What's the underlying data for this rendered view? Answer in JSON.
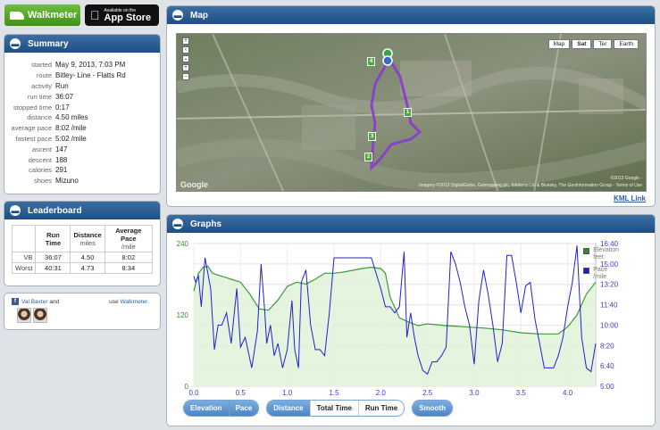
{
  "header": {
    "walkmeter_logo": "Walkmeter",
    "appstore_small": "Available on the",
    "appstore_big": "App Store"
  },
  "summary": {
    "title": "Summary",
    "rows": [
      {
        "label": "started",
        "value": "May 9, 2013, 7:03 PM"
      },
      {
        "label": "route",
        "value": "Bitley- Line - Flatts Rd"
      },
      {
        "label": "activity",
        "value": "Run"
      },
      {
        "label": "run time",
        "value": "36:07"
      },
      {
        "label": "stopped time",
        "value": "0:17"
      },
      {
        "label": "distance",
        "value": "4.50 miles"
      },
      {
        "label": "average pace",
        "value": "8:02 /mile"
      },
      {
        "label": "fastest pace",
        "value": "5:02 /mile"
      },
      {
        "label": "ascent",
        "value": "147"
      },
      {
        "label": "descent",
        "value": "188"
      },
      {
        "label": "calories",
        "value": "291"
      },
      {
        "label": "shoes",
        "value": "Mizuno"
      }
    ]
  },
  "leaderboard": {
    "title": "Leaderboard",
    "headers": {
      "run_time": "Run Time",
      "distance": "Distance",
      "distance_unit": "miles",
      "pace": "Average Pace",
      "pace_unit": "/mile"
    },
    "rows": [
      {
        "name": "VB",
        "time": "36:07",
        "distance": "4.50",
        "pace": "8:02"
      },
      {
        "name": "Worst",
        "time": "40:31",
        "distance": "4.73",
        "pace": "8:34"
      }
    ]
  },
  "social": {
    "name": "Val Baxter",
    "and": "and",
    "use": "use",
    "app": "Walkmeter",
    "dot": "."
  },
  "map": {
    "title": "Map",
    "types": [
      "Map",
      "Sat",
      "Ter",
      "Earth"
    ],
    "selected_type": "Sat",
    "kml_link": "KML Link",
    "copyright_google": "©2013 Google ·",
    "copyright_imagery": "Imagery ©2013 DigitalGlobe, Getmapping plc, Infoterra Ltd & Bluesky, The GeoInformation Group · Terms of Use",
    "google_logo": "Google",
    "waypoints": [
      "4",
      "1",
      "3",
      "2"
    ]
  },
  "graphs": {
    "title": "Graphs",
    "legend": [
      {
        "name": "Elevation",
        "unit": "feet",
        "color": "#2e8b2e"
      },
      {
        "name": "Pace",
        "unit": "/mile",
        "color": "#1a1adc"
      }
    ],
    "buttons": {
      "group1": [
        {
          "label": "Elevation",
          "on": true
        },
        {
          "label": "Pace",
          "on": true
        }
      ],
      "group2": [
        {
          "label": "Distance",
          "on": true
        },
        {
          "label": "Total Time",
          "on": false
        },
        {
          "label": "Run Time",
          "on": false
        }
      ],
      "group3": [
        {
          "label": "Smooth",
          "on": true
        }
      ]
    }
  },
  "chart_data": {
    "type": "line",
    "x_ticks": [
      "0.0",
      "0.5",
      "1.0",
      "1.5",
      "2.0",
      "2.5",
      "3.0",
      "3.5",
      "4.0"
    ],
    "y_left_ticks": [
      "240",
      "120",
      "0"
    ],
    "y_right_ticks": [
      "16:40",
      "15:00",
      "13:20",
      "11:40",
      "10:00",
      "8:20",
      "6:40",
      "5:00"
    ],
    "xlim": [
      0,
      4.3
    ],
    "ylim_left": [
      0,
      240
    ],
    "ylim_right_minutes": [
      5.0,
      16.667
    ],
    "series": [
      {
        "name": "Elevation",
        "axis": "left",
        "x": [
          0,
          0.05,
          0.1,
          0.15,
          0.2,
          0.3,
          0.4,
          0.5,
          0.6,
          0.7,
          0.8,
          0.9,
          1.0,
          1.1,
          1.2,
          1.3,
          1.4,
          1.5,
          1.6,
          1.7,
          1.8,
          1.9,
          2.0,
          2.05,
          2.1,
          2.2,
          2.3,
          2.4,
          2.5,
          2.7,
          2.9,
          3.1,
          3.3,
          3.5,
          3.7,
          3.8,
          3.9,
          4.0,
          4.1,
          4.2,
          4.3
        ],
        "values": [
          160,
          190,
          200,
          202,
          190,
          185,
          180,
          175,
          155,
          130,
          128,
          145,
          168,
          175,
          172,
          180,
          190,
          190,
          192,
          195,
          198,
          200,
          198,
          190,
          150,
          115,
          108,
          102,
          105,
          102,
          100,
          98,
          95,
          90,
          88,
          88,
          88,
          100,
          120,
          155,
          175
        ]
      },
      {
        "name": "Pace",
        "axis": "right",
        "x": [
          0,
          0.02,
          0.05,
          0.08,
          0.12,
          0.18,
          0.22,
          0.26,
          0.3,
          0.35,
          0.4,
          0.46,
          0.5,
          0.55,
          0.62,
          0.68,
          0.72,
          0.76,
          0.78,
          0.82,
          0.86,
          0.9,
          0.95,
          1.0,
          1.05,
          1.08,
          1.12,
          1.15,
          1.2,
          1.25,
          1.3,
          1.35,
          1.4,
          1.45,
          1.5,
          1.55,
          1.6,
          1.7,
          1.8,
          1.9,
          2.0,
          2.05,
          2.1,
          2.15,
          2.2,
          2.25,
          2.28,
          2.32,
          2.36,
          2.4,
          2.45,
          2.5,
          2.55,
          2.6,
          2.65,
          2.7,
          2.75,
          2.8,
          2.85,
          2.9,
          2.95,
          3.0,
          3.05,
          3.1,
          3.15,
          3.2,
          3.25,
          3.3,
          3.35,
          3.4,
          3.45,
          3.5,
          3.55,
          3.6,
          3.65,
          3.7,
          3.75,
          3.8,
          3.85,
          3.9,
          3.95,
          4.0,
          4.05,
          4.1,
          4.15,
          4.2,
          4.25,
          4.3
        ],
        "values": [
          14.0,
          13.5,
          14.0,
          11.5,
          15.5,
          13.0,
          8.0,
          10.0,
          10.0,
          11.0,
          8.5,
          13.0,
          8.2,
          9.0,
          6.5,
          9.5,
          15.0,
          11.0,
          8.5,
          10.0,
          7.5,
          8.5,
          6.5,
          8.0,
          12.0,
          8.0,
          6.5,
          13.5,
          14.5,
          10.0,
          8.0,
          8.0,
          7.5,
          11.0,
          15.5,
          15.5,
          15.5,
          15.5,
          15.5,
          15.5,
          13.0,
          11.5,
          11.5,
          11.0,
          11.5,
          16.0,
          9.0,
          11.0,
          9.0,
          7.5,
          6.3,
          6.0,
          7.0,
          7.0,
          7.5,
          8.2,
          16.0,
          15.0,
          13.5,
          11.5,
          10.0,
          6.8,
          12.0,
          14.5,
          12.5,
          10.0,
          7.0,
          8.5,
          15.7,
          15.7,
          13.5,
          11.0,
          13.2,
          13.5,
          10.5,
          8.5,
          6.5,
          6.5,
          6.5,
          7.5,
          9.0,
          11.5,
          13.5,
          16.5,
          9.0,
          6.5,
          6.2,
          8.5
        ]
      }
    ]
  }
}
